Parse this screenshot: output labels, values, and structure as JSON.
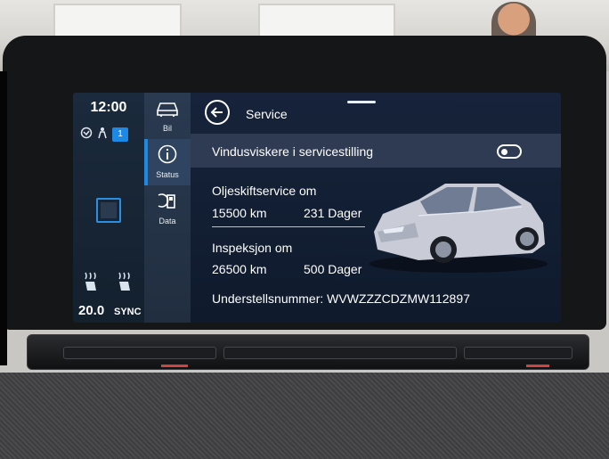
{
  "climate": {
    "clock": "12:00",
    "badge": "1",
    "temperature": "20.0",
    "sync_label": "SYNC"
  },
  "nav": {
    "items": [
      {
        "label": "Bil",
        "icon": "car-icon"
      },
      {
        "label": "Status",
        "icon": "info-icon"
      },
      {
        "label": "Data",
        "icon": "fuel-data-icon"
      }
    ],
    "active": "Status"
  },
  "page": {
    "title": "Service",
    "wiper": {
      "label": "Vindusviskere i servicestilling",
      "toggle_on": false
    },
    "oil": {
      "label": "Oljeskiftservice om",
      "distance": "15500 km",
      "days": "231 Dager"
    },
    "inspection": {
      "label": "Inspeksjon om",
      "distance": "26500 km",
      "days": "500 Dager"
    },
    "vin": "Understellsnummer: WVWZZZCDZMW112897"
  },
  "colors": {
    "accent": "#1e88e5",
    "background": "#0f1a2c",
    "highlight_row": "#2f3b52"
  }
}
